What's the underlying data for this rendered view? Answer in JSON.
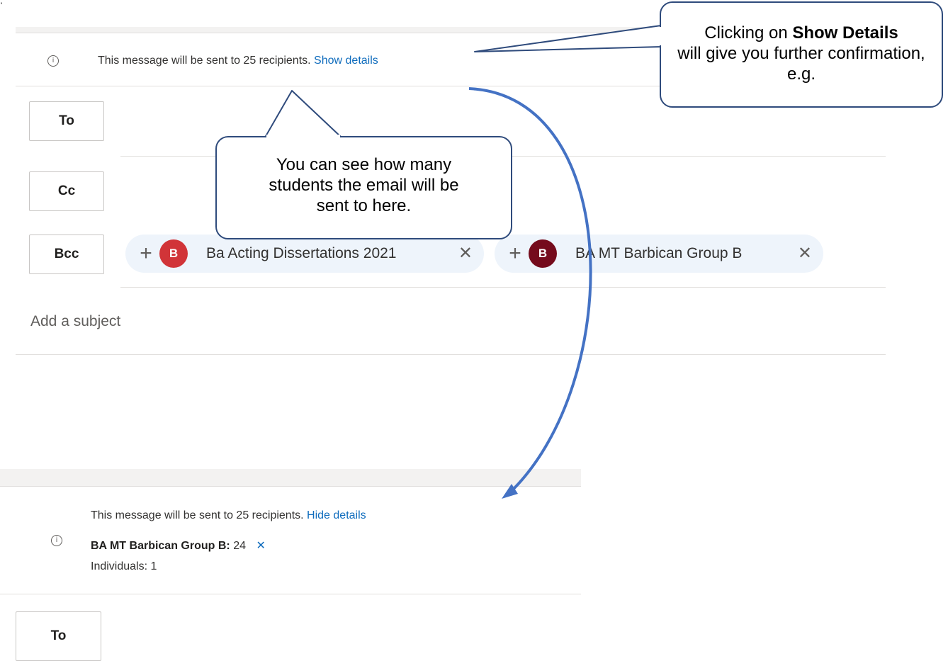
{
  "top_panel": {
    "info_icon": "info-icon",
    "notice_text": "This message will be sent to 25 recipients.",
    "show_details": "Show details",
    "to_label": "To",
    "cc_label": "Cc",
    "bcc_label": "Bcc",
    "recipients": [
      {
        "avatar_letter": "B",
        "name": "Ba Acting Dissertations 2021",
        "avatar_color": "#d13438"
      },
      {
        "avatar_letter": "B",
        "name": "BA MT Barbican Group B",
        "avatar_color": "#750b1c"
      }
    ],
    "subject_placeholder": "Add a subject"
  },
  "callouts": {
    "bottom_callout": "You can see how many students the email will be sent to here.",
    "top_callout_prefix": "Clicking on ",
    "top_callout_bold": "Show Details",
    "top_callout_suffix": " will give you further confirmation, e.g."
  },
  "bottom_panel": {
    "notice_text": "This message will be sent to 25 recipients.",
    "hide_details": "Hide details",
    "group_name": "BA MT Barbican Group B:",
    "group_count": "24",
    "individuals": "Individuals: 1",
    "to_label": "To"
  },
  "colors": {
    "link": "#0f6cbd",
    "callout_border": "#2f4b7c",
    "arrow": "#4472c4"
  }
}
